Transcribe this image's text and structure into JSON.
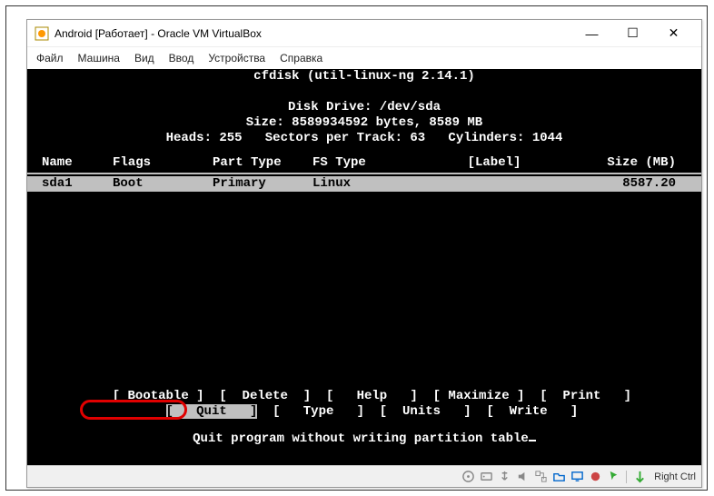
{
  "window": {
    "title": "Android [Работает] - Oracle VM VirtualBox"
  },
  "menubar": {
    "file": "Файл",
    "machine": "Машина",
    "view": "Вид",
    "input": "Ввод",
    "devices": "Устройства",
    "help": "Справка"
  },
  "term": {
    "app_title": "cfdisk (util-linux-ng 2.14.1)",
    "drive_line": "Disk Drive: /dev/sda",
    "size_line": "Size: 8589934592 bytes, 8589 MB",
    "geom_line": "Heads: 255   Sectors per Track: 63   Cylinders: 1044",
    "header": {
      "name": "Name",
      "flags": "Flags",
      "parttype": "Part Type",
      "fstype": "FS Type",
      "label": "[Label]",
      "size": "Size (MB)"
    },
    "row": {
      "name": "sda1",
      "flags": "Boot",
      "parttype": "Primary",
      "fstype": "Linux",
      "label": "",
      "size": "8587.20"
    },
    "actions": {
      "bootable": "Bootable",
      "delete": "Delete",
      "help": "Help",
      "maximize": "Maximize",
      "print": "Print",
      "quit": "Quit",
      "type": "Type",
      "units": "Units",
      "write": "Write"
    },
    "hint": "Quit program without writing partition table"
  },
  "statusbar": {
    "hostkey": "Right Ctrl"
  }
}
